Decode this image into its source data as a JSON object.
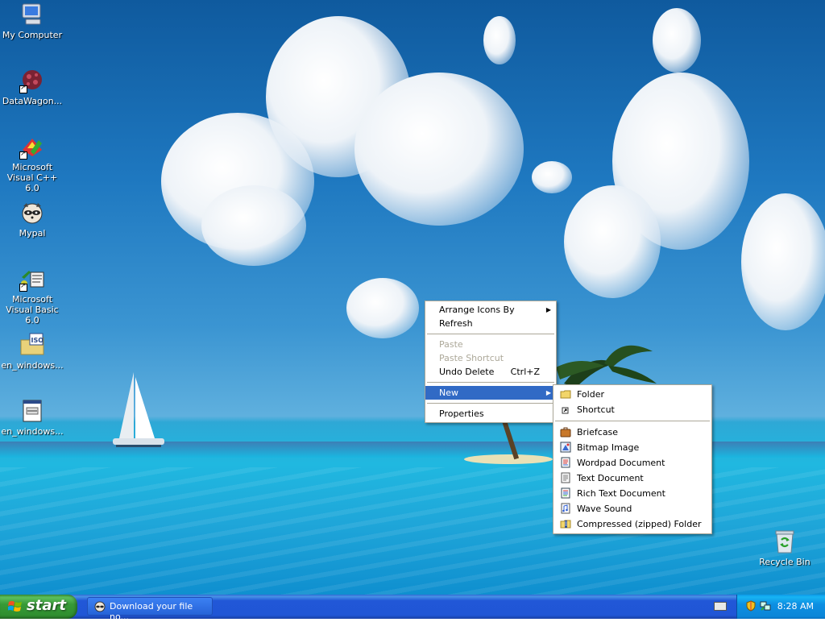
{
  "desktop_icons": [
    {
      "label": "My Computer"
    },
    {
      "label": "DataWagon..."
    },
    {
      "label": "Microsoft Visual C++ 6.0"
    },
    {
      "label": "Mypal"
    },
    {
      "label": "Microsoft Visual Basic 6.0"
    },
    {
      "label": "en_windows..."
    },
    {
      "label": "en_windows..."
    },
    {
      "label": "Recycle Bin"
    }
  ],
  "context_menu": {
    "items": [
      {
        "label": "Arrange Icons By"
      },
      {
        "label": "Refresh"
      },
      {
        "label": "Paste"
      },
      {
        "label": "Paste Shortcut"
      },
      {
        "label": "Undo Delete",
        "accel": "Ctrl+Z"
      },
      {
        "label": "New"
      },
      {
        "label": "Properties"
      }
    ]
  },
  "new_submenu": {
    "items": [
      {
        "label": "Folder"
      },
      {
        "label": "Shortcut"
      },
      {
        "label": "Briefcase"
      },
      {
        "label": "Bitmap Image"
      },
      {
        "label": "Wordpad Document"
      },
      {
        "label": "Text Document"
      },
      {
        "label": "Rich Text Document"
      },
      {
        "label": "Wave Sound"
      },
      {
        "label": "Compressed (zipped) Folder"
      }
    ]
  },
  "taskbar": {
    "start_label": "start",
    "task_button": "Download your file no...",
    "clock": "8:28 AM"
  },
  "colors": {
    "taskbar_blue": "#245edb",
    "start_green": "#3c9a3c",
    "menu_highlight": "#316ac5",
    "tray_blue": "#0b86d8"
  }
}
